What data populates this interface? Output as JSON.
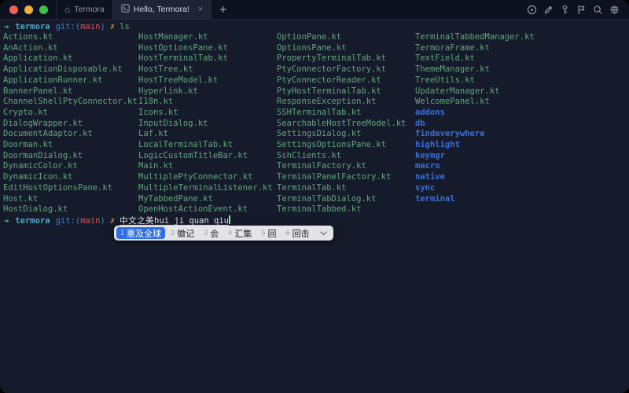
{
  "titlebar": {
    "home_tab": {
      "label": "Termora"
    },
    "active_tab": {
      "label": "Hello, Termora!",
      "close_glyph": "×"
    },
    "new_tab_glyph": "+",
    "home_glyph": "⌂"
  },
  "terminal": {
    "prompt": {
      "arrow": "→",
      "host": "termora",
      "git_prefix": "git:(",
      "branch": "main",
      "git_suffix": ")",
      "dirty_mark": "✗"
    },
    "command": "ls",
    "composition": {
      "committed": "中文之美",
      "pinyin": "hui ji quan qiu"
    },
    "ls_columns": [
      [
        {
          "name": "Actions.kt",
          "type": "file"
        },
        {
          "name": "AnAction.kt",
          "type": "file"
        },
        {
          "name": "Application.kt",
          "type": "file"
        },
        {
          "name": "ApplicationDisposable.kt",
          "type": "file"
        },
        {
          "name": "ApplicationRunner.kt",
          "type": "file"
        },
        {
          "name": "BannerPanel.kt",
          "type": "file"
        },
        {
          "name": "ChannelShellPtyConnector.kt",
          "type": "file"
        },
        {
          "name": "Crypto.kt",
          "type": "file"
        },
        {
          "name": "DialogWrapper.kt",
          "type": "file"
        },
        {
          "name": "DocumentAdaptor.kt",
          "type": "file"
        },
        {
          "name": "Doorman.kt",
          "type": "file"
        },
        {
          "name": "DoormanDialog.kt",
          "type": "file"
        },
        {
          "name": "DynamicColor.kt",
          "type": "file"
        },
        {
          "name": "DynamicIcon.kt",
          "type": "file"
        },
        {
          "name": "EditHostOptionsPane.kt",
          "type": "file"
        },
        {
          "name": "Host.kt",
          "type": "file"
        },
        {
          "name": "HostDialog.kt",
          "type": "file"
        }
      ],
      [
        {
          "name": "HostManager.kt",
          "type": "file"
        },
        {
          "name": "HostOptionsPane.kt",
          "type": "file"
        },
        {
          "name": "HostTerminalTab.kt",
          "type": "file"
        },
        {
          "name": "HostTree.kt",
          "type": "file"
        },
        {
          "name": "HostTreeModel.kt",
          "type": "file"
        },
        {
          "name": "Hyperlink.kt",
          "type": "file"
        },
        {
          "name": "I18n.kt",
          "type": "file"
        },
        {
          "name": "Icons.kt",
          "type": "file"
        },
        {
          "name": "InputDialog.kt",
          "type": "file"
        },
        {
          "name": "Laf.kt",
          "type": "file"
        },
        {
          "name": "LocalTerminalTab.kt",
          "type": "file"
        },
        {
          "name": "LogicCustomTitleBar.kt",
          "type": "file"
        },
        {
          "name": "Main.kt",
          "type": "file"
        },
        {
          "name": "MultiplePtyConnector.kt",
          "type": "file"
        },
        {
          "name": "MultipleTerminalListener.kt",
          "type": "file"
        },
        {
          "name": "MyTabbedPane.kt",
          "type": "file"
        },
        {
          "name": "OpenHostActionEvent.kt",
          "type": "file"
        }
      ],
      [
        {
          "name": "OptionPane.kt",
          "type": "file"
        },
        {
          "name": "OptionsPane.kt",
          "type": "file"
        },
        {
          "name": "PropertyTerminalTab.kt",
          "type": "file"
        },
        {
          "name": "PtyConnectorFactory.kt",
          "type": "file"
        },
        {
          "name": "PtyConnectorReader.kt",
          "type": "file"
        },
        {
          "name": "PtyHostTerminalTab.kt",
          "type": "file"
        },
        {
          "name": "ResponseException.kt",
          "type": "file"
        },
        {
          "name": "SSHTerminalTab.kt",
          "type": "file"
        },
        {
          "name": "SearchableHostTreeModel.kt",
          "type": "file"
        },
        {
          "name": "SettingsDialog.kt",
          "type": "file"
        },
        {
          "name": "SettingsOptionsPane.kt",
          "type": "file"
        },
        {
          "name": "SshClients.kt",
          "type": "file"
        },
        {
          "name": "TerminalFactory.kt",
          "type": "file"
        },
        {
          "name": "TerminalPanelFactory.kt",
          "type": "file"
        },
        {
          "name": "TerminalTab.kt",
          "type": "file"
        },
        {
          "name": "TerminalTabDialog.kt",
          "type": "file"
        },
        {
          "name": "TerminalTabbed.kt",
          "type": "file"
        }
      ],
      [
        {
          "name": "TerminalTabbedManager.kt",
          "type": "file"
        },
        {
          "name": "TermoraFrame.kt",
          "type": "file"
        },
        {
          "name": "TextField.kt",
          "type": "file"
        },
        {
          "name": "ThemeManager.kt",
          "type": "file"
        },
        {
          "name": "TreeUtils.kt",
          "type": "file"
        },
        {
          "name": "UpdaterManager.kt",
          "type": "file"
        },
        {
          "name": "WelcomePanel.kt",
          "type": "file"
        },
        {
          "name": "addons",
          "type": "dir"
        },
        {
          "name": "db",
          "type": "dir"
        },
        {
          "name": "findeverywhere",
          "type": "dir"
        },
        {
          "name": "highlight",
          "type": "dir"
        },
        {
          "name": "keymgr",
          "type": "dir"
        },
        {
          "name": "macro",
          "type": "dir"
        },
        {
          "name": "native",
          "type": "dir"
        },
        {
          "name": "sync",
          "type": "dir"
        },
        {
          "name": "terminal",
          "type": "dir"
        }
      ]
    ]
  },
  "ime": {
    "candidates": [
      {
        "index": "1",
        "text": "惠及全球",
        "selected": true
      },
      {
        "index": "2",
        "text": "徽记",
        "selected": false
      },
      {
        "index": "3",
        "text": "会",
        "selected": false
      },
      {
        "index": "4",
        "text": "汇集",
        "selected": false
      },
      {
        "index": "5",
        "text": "回",
        "selected": false
      },
      {
        "index": "6",
        "text": "回击",
        "selected": false
      }
    ]
  },
  "colors": {
    "terminal_bg": "#161b2b",
    "titlebar_bg": "#0e1220",
    "file_green": "#5fa779",
    "dir_blue": "#3b6ed6",
    "prompt_arrow_green": "#43c383",
    "host_cyan": "#4fa9c4",
    "git_blue": "#4a7bd0",
    "branch_red": "#cc5a5f",
    "dirty_yellow": "#d9a23f",
    "ime_selected_blue": "#2e6ee6"
  }
}
